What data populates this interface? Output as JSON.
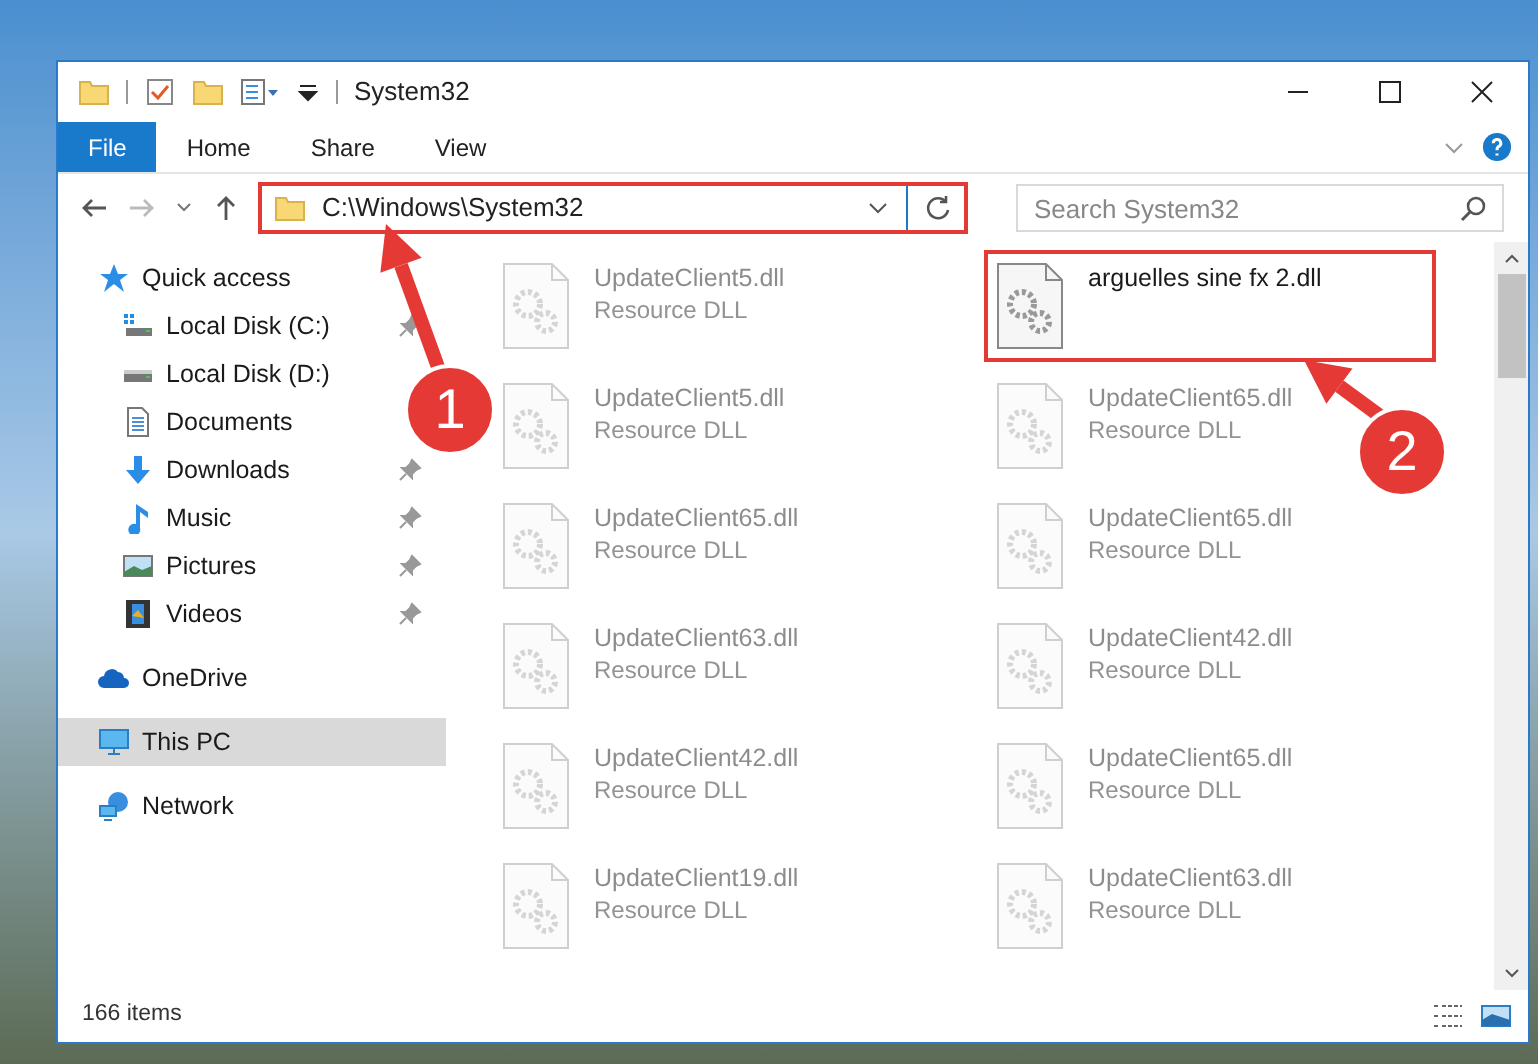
{
  "window": {
    "title": "System32"
  },
  "ribbon": {
    "tabs": [
      {
        "label": "File",
        "selected": true
      },
      {
        "label": "Home",
        "selected": false
      },
      {
        "label": "Share",
        "selected": false
      },
      {
        "label": "View",
        "selected": false
      }
    ]
  },
  "address_bar": {
    "path": "C:\\Windows\\System32",
    "annotated": true
  },
  "search": {
    "placeholder": "Search System32"
  },
  "sidebar": {
    "items": [
      {
        "label": "Quick access",
        "kind": "star",
        "selected": false,
        "children": [
          {
            "label": "Local Disk (C:)",
            "kind": "system-drive",
            "pinned": true,
            "selected": false
          },
          {
            "label": "Local Disk (D:)",
            "kind": "drive",
            "pinned": false,
            "selected": false
          },
          {
            "label": "Documents",
            "kind": "documents",
            "pinned": false,
            "selected": false
          },
          {
            "label": "Downloads",
            "kind": "downloads",
            "pinned": true,
            "selected": false
          },
          {
            "label": "Music",
            "kind": "music",
            "pinned": true,
            "selected": false
          },
          {
            "label": "Pictures",
            "kind": "pictures",
            "pinned": true,
            "selected": false
          },
          {
            "label": "Videos",
            "kind": "videos",
            "pinned": true,
            "selected": false
          }
        ]
      },
      {
        "label": "OneDrive",
        "kind": "cloud",
        "selected": false
      },
      {
        "label": "This PC",
        "kind": "computer",
        "selected": true
      },
      {
        "label": "Network",
        "kind": "network",
        "selected": false
      }
    ]
  },
  "files": [
    {
      "name": "UpdateClient5.dll",
      "type": "Resource DLL",
      "faded": true,
      "annotated": false
    },
    {
      "name": "arguelles sine fx 2.dll",
      "faded": false,
      "annotated": true
    },
    {
      "name": "UpdateClient5.dll",
      "type": "Resource DLL",
      "faded": true,
      "annotated": false
    },
    {
      "name": "UpdateClient65.dll",
      "type": "Resource DLL",
      "faded": true,
      "annotated": false
    },
    {
      "name": "UpdateClient65.dll",
      "type": "Resource DLL",
      "faded": true,
      "annotated": false
    },
    {
      "name": "UpdateClient65.dll",
      "type": "Resource DLL",
      "faded": true,
      "annotated": false
    },
    {
      "name": "UpdateClient63.dll",
      "type": "Resource DLL",
      "faded": true,
      "annotated": false
    },
    {
      "name": "UpdateClient42.dll",
      "type": "Resource DLL",
      "faded": true,
      "annotated": false
    },
    {
      "name": "UpdateClient42.dll",
      "type": "Resource DLL",
      "faded": true,
      "annotated": false
    },
    {
      "name": "UpdateClient65.dll",
      "type": "Resource DLL",
      "faded": true,
      "annotated": false
    },
    {
      "name": "UpdateClient19.dll",
      "type": "Resource DLL",
      "faded": true,
      "annotated": false
    },
    {
      "name": "UpdateClient63.dll",
      "type": "Resource DLL",
      "faded": true,
      "annotated": false
    }
  ],
  "status_bar": {
    "item_count": "166 items"
  },
  "annotations": [
    {
      "label": "1"
    },
    {
      "label": "2"
    }
  ]
}
